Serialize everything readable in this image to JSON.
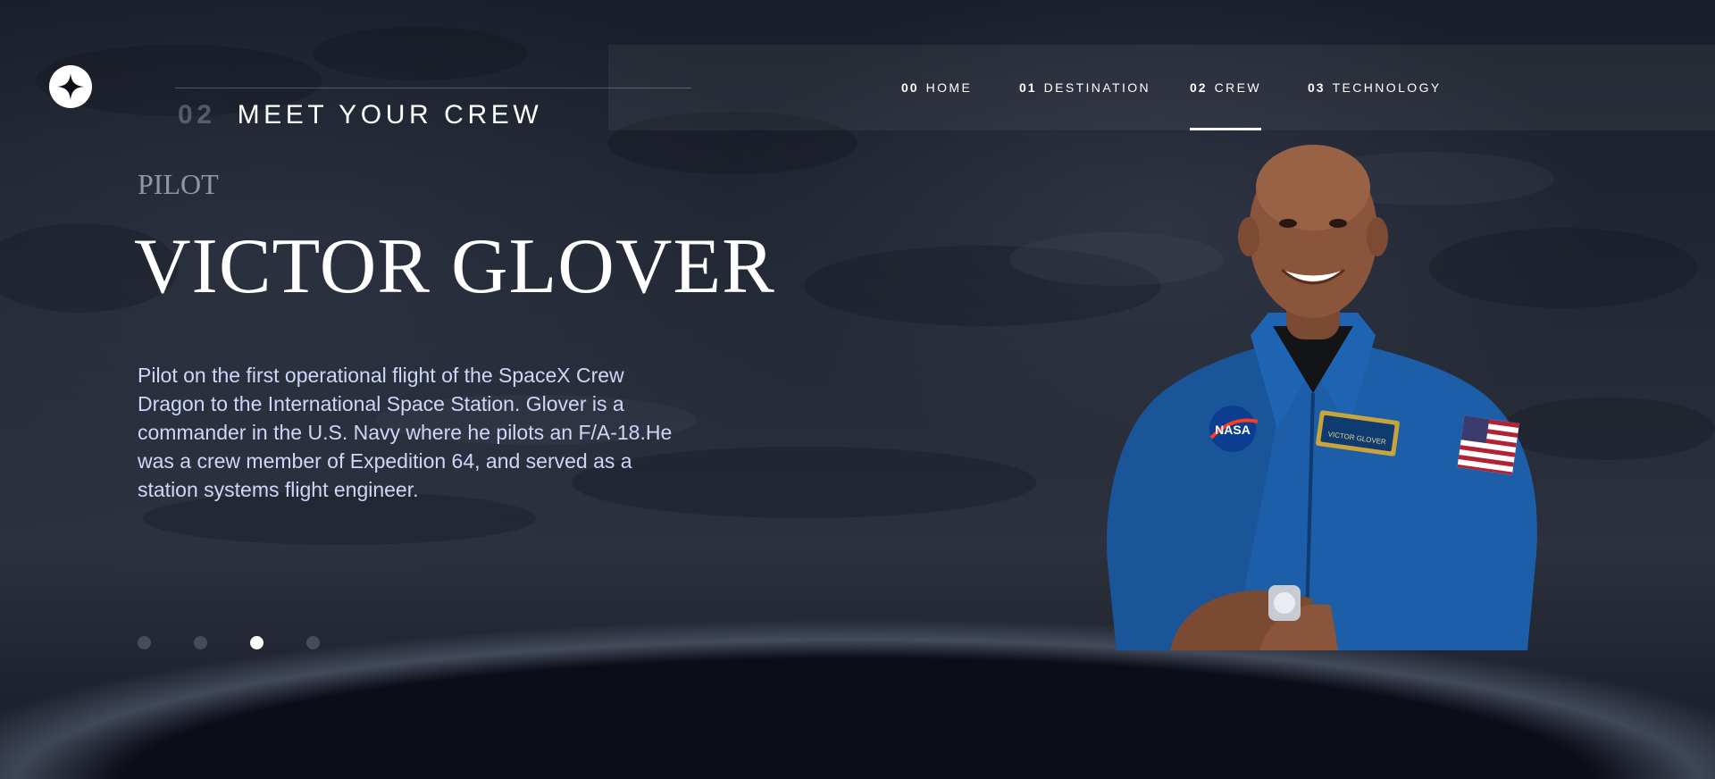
{
  "nav": {
    "items": [
      {
        "num": "00",
        "label": "HOME"
      },
      {
        "num": "01",
        "label": "DESTINATION"
      },
      {
        "num": "02",
        "label": "CREW",
        "active": true
      },
      {
        "num": "03",
        "label": "TECHNOLOGY"
      }
    ]
  },
  "page": {
    "section_number": "02",
    "section_title": "MEET YOUR CREW"
  },
  "crew": {
    "role": "Pilot",
    "name": "VICTOR GLOVER",
    "bio": "Pilot on the first operational flight of the SpaceX Crew Dragon to the International Space Station. Glover is a commander in the U.S. Navy where he pilots an F/A-18.He was a crew member of Expedition 64, and served as a station systems flight engineer.",
    "badge_text": "NASA",
    "name_tag": "VICTOR GLOVER"
  },
  "pagination": {
    "count": 4,
    "active_index": 2
  },
  "colors": {
    "background": "#0b0d17",
    "accent_text": "#d0d6f9",
    "suit": "#1d5ea8"
  },
  "icons": {
    "logo": "star-logo-icon"
  }
}
